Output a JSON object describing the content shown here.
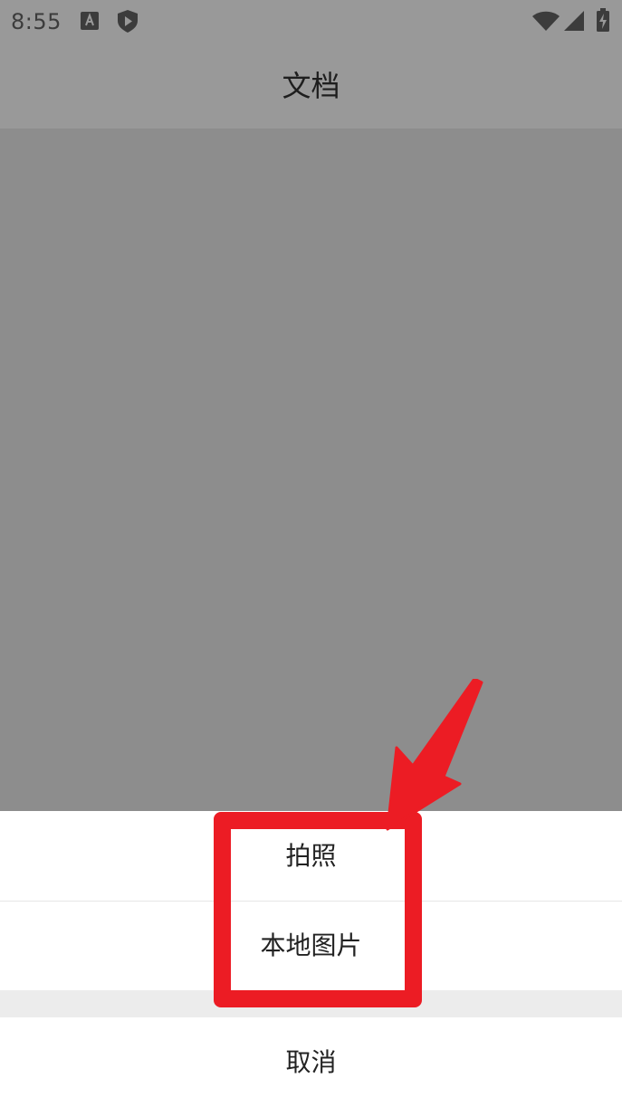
{
  "status_bar": {
    "time": "8:55",
    "icons": [
      "font-a-icon",
      "shield-play-icon",
      "wifi-icon",
      "cell-signal-icon",
      "battery-charging-icon"
    ]
  },
  "app_bar": {
    "title": "文档"
  },
  "action_sheet": {
    "options": [
      {
        "label": "拍照"
      },
      {
        "label": "本地图片"
      }
    ],
    "cancel_label": "取消"
  },
  "colors": {
    "overlay": "#8d8d8d",
    "annotation": "#ec1c24"
  }
}
